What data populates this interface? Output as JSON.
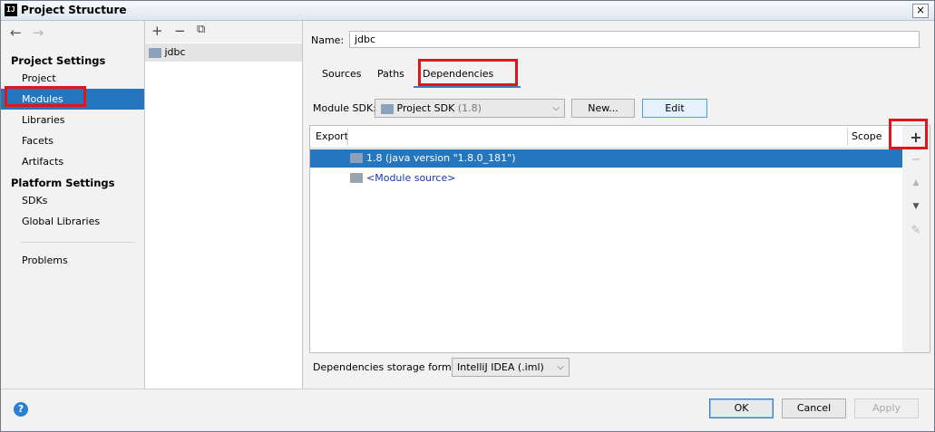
{
  "window": {
    "title": "Project Structure",
    "app_icon": "IJ",
    "close_glyph": "×"
  },
  "nav": {
    "back": "←",
    "forward": "→",
    "project_settings_header": "Project Settings",
    "project_settings": [
      "Project",
      "Modules",
      "Libraries",
      "Facets",
      "Artifacts"
    ],
    "platform_settings_header": "Platform Settings",
    "platform_settings": [
      "SDKs",
      "Global Libraries"
    ],
    "problems": "Problems",
    "selected": "Modules"
  },
  "modules_toolbar": {
    "add": "+",
    "remove": "−",
    "copy": "⧉"
  },
  "modules": [
    "jdbc"
  ],
  "name_label": "Name:",
  "name_value": "jdbc",
  "tabs": [
    "Sources",
    "Paths",
    "Dependencies"
  ],
  "active_tab": "Dependencies",
  "module_sdk": {
    "label": "Module SDK:",
    "selected": "Project SDK",
    "version": "(1.8)",
    "new_button": "New...",
    "edit_button": "Edit"
  },
  "table": {
    "headers": {
      "export": "Export",
      "scope": "Scope"
    },
    "rows": [
      {
        "label": "1.8 (java version \"1.8.0_181\")",
        "selected": true
      },
      {
        "label": "<Module source>",
        "selected": false
      }
    ]
  },
  "side_tools": {
    "add": "+",
    "remove": "−",
    "up": "▲",
    "down": "▼",
    "edit": "✎"
  },
  "storage_format": {
    "label": "Dependencies storage format:",
    "selected": "IntelliJ IDEA (.iml)"
  },
  "footer": {
    "help": "?",
    "ok": "OK",
    "cancel": "Cancel",
    "apply": "Apply"
  }
}
